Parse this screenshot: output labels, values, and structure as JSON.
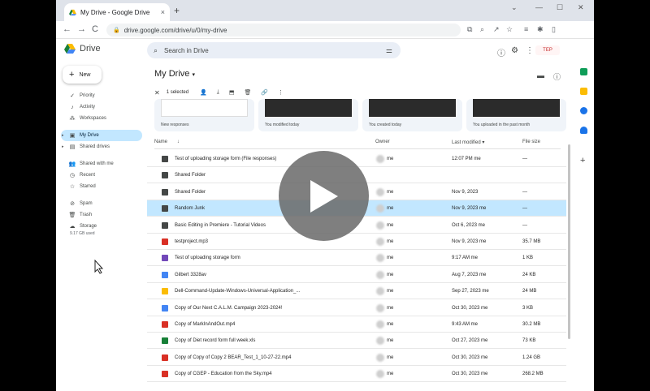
{
  "browser": {
    "tab_title": "My Drive - Google Drive",
    "tab_close": "×",
    "new_tab": "+",
    "url": "drive.google.com/drive/u/0/my-drive",
    "back": "←",
    "forward": "→",
    "reload": "C",
    "win_min": "—",
    "win_max": "☐",
    "win_close": "✕"
  },
  "header": {
    "logo_text": "Drive",
    "search_placeholder": "Search in Drive",
    "brand_badge": "ΤΕΡ"
  },
  "sidebar": {
    "new_label": "New",
    "items": [
      {
        "label": "Priority",
        "icon": "check-circle-icon"
      },
      {
        "label": "Activity",
        "icon": "bell-icon"
      },
      {
        "label": "Workspaces",
        "icon": "workspaces-icon"
      },
      {
        "label": "My Drive",
        "icon": "my-drive-icon"
      },
      {
        "label": "Shared drives",
        "icon": "shared-drives-icon"
      },
      {
        "label": "Shared with me",
        "icon": "people-icon"
      },
      {
        "label": "Recent",
        "icon": "clock-icon"
      },
      {
        "label": "Starred",
        "icon": "star-icon"
      },
      {
        "label": "Spam",
        "icon": "spam-icon"
      },
      {
        "label": "Trash",
        "icon": "trash-icon"
      },
      {
        "label": "Storage",
        "icon": "cloud-icon"
      }
    ],
    "storage_used": "9.17 GB used"
  },
  "main": {
    "title": "My Drive",
    "title_caret": "▾",
    "selection": {
      "count": "1 selected"
    },
    "suggestions": [
      {
        "caption": "New responses"
      },
      {
        "caption": "You modified today"
      },
      {
        "caption": "You created today"
      },
      {
        "caption": "You uploaded in the past month"
      }
    ],
    "columns": {
      "name": "Name",
      "sort_arrow": "↓",
      "owner": "Owner",
      "modified": "Last modified",
      "modified_caret": "▾",
      "size": "File size"
    },
    "rows": [
      {
        "name": "Test of uploading storage form (File responses)",
        "owner": "me",
        "modified": "12:07 PM me",
        "size": "—",
        "icon": "folder-icon",
        "color": "#444746"
      },
      {
        "name": "Shared Folder",
        "owner": "",
        "modified": "",
        "size": "",
        "icon": "shared-folder-icon",
        "color": "#444746"
      },
      {
        "name": "Shared Folder",
        "owner": "me",
        "modified": "Nov 9, 2023",
        "size": "—",
        "icon": "folder-icon",
        "color": "#444746"
      },
      {
        "name": "Random Junk",
        "owner": "me",
        "modified": "Nov 9, 2023 me",
        "size": "—",
        "icon": "folder-icon",
        "color": "#444746"
      },
      {
        "name": "Basic Editing in Premiere - Tutorial Videos",
        "owner": "me",
        "modified": "Oct 6, 2023 me",
        "size": "—",
        "icon": "folder-icon",
        "color": "#444746"
      },
      {
        "name": "testproject.mp3",
        "owner": "me",
        "modified": "Nov 9, 2023 me",
        "size": "35.7 MB",
        "icon": "audio-icon",
        "color": "#d93025"
      },
      {
        "name": "Test of uploading storage form",
        "owner": "me",
        "modified": "9:17 AM me",
        "size": "1 KB",
        "icon": "forms-icon",
        "color": "#7248b9"
      },
      {
        "name": "Gilbert 3328av",
        "owner": "me",
        "modified": "Aug 7, 2023 me",
        "size": "24 KB",
        "icon": "docs-icon",
        "color": "#4285f4"
      },
      {
        "name": "Dell-Command-Update-Windows-Universal-Application_...",
        "owner": "me",
        "modified": "Sep 27, 2023 me",
        "size": "24 MB",
        "icon": "file-icon",
        "color": "#fbbc04"
      },
      {
        "name": "Copy of Our Next C.A.L.M. Campaign 2023-2024!",
        "owner": "me",
        "modified": "Oct 30, 2023 me",
        "size": "3 KB",
        "icon": "docs-icon",
        "color": "#4285f4"
      },
      {
        "name": "Copy of MarkInAndOut.mp4",
        "owner": "me",
        "modified": "9:43 AM me",
        "size": "30.2 MB",
        "icon": "video-icon",
        "color": "#d93025"
      },
      {
        "name": "Copy of Diet record form full week.xls",
        "owner": "me",
        "modified": "Oct 27, 2023 me",
        "size": "73 KB",
        "icon": "sheets-icon",
        "color": "#188038"
      },
      {
        "name": "Copy of Copy of Copy 2 BEAR_Test_1_10-27-22.mp4",
        "owner": "me",
        "modified": "Oct 30, 2023 me",
        "size": "1.24 GB",
        "icon": "video-icon",
        "color": "#d93025"
      },
      {
        "name": "Copy of CGEP - Education from the Sky.mp4",
        "owner": "me",
        "modified": "Oct 30, 2023 me",
        "size": "268.2 MB",
        "icon": "video-icon",
        "color": "#d93025"
      }
    ]
  },
  "colors": {
    "selected_row": "#c2e7ff",
    "active_nav": "#c2e7ff",
    "search_bg": "#e9eef6"
  }
}
